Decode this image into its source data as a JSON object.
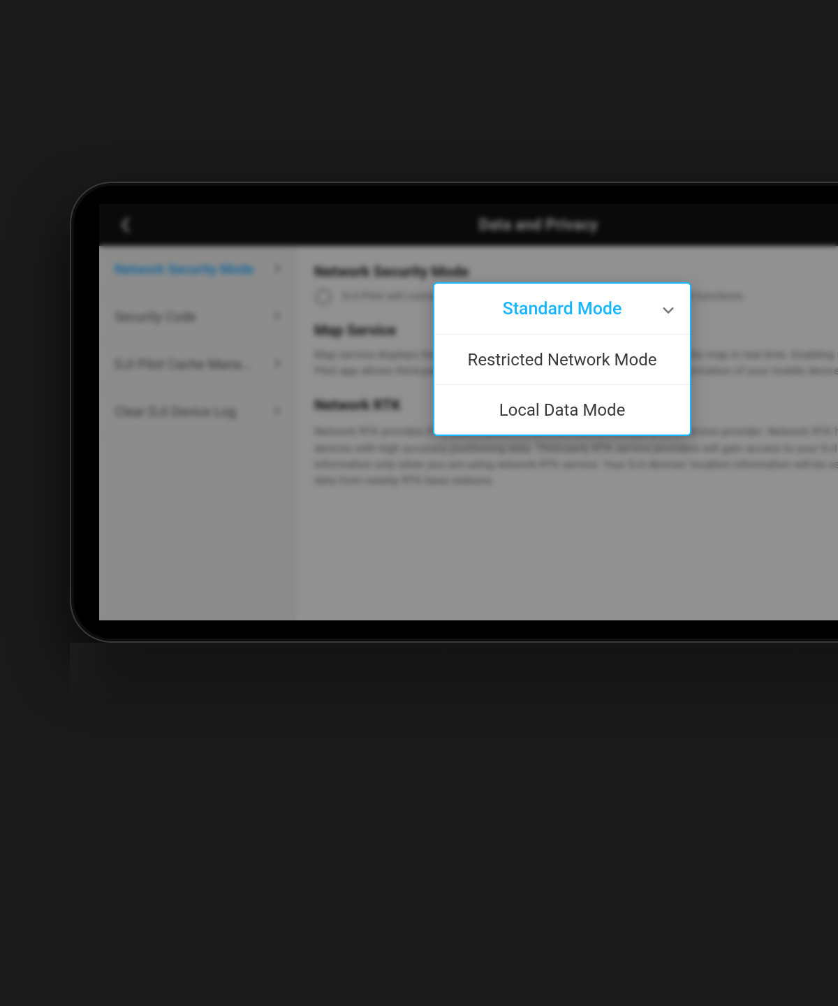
{
  "header": {
    "title": "Data and Privacy"
  },
  "sidebar": {
    "items": [
      {
        "label": "Network Security Mode",
        "active": true
      },
      {
        "label": "Security Code",
        "active": false
      },
      {
        "label": "DJI Pilot Cache Mana...",
        "active": false
      },
      {
        "label": "Clear DJI Device Log",
        "active": false
      }
    ]
  },
  "content": {
    "network_security": {
      "heading": "Network Security Mode",
      "desc": "DJI Pilot will connect to the internet and provide complete features and functions."
    },
    "map_service": {
      "heading": "Map Service",
      "desc": "Map service displays the location of your DJI devices and mobile device on the map in real time. Enabling map services in the DJI Pilot app allows third-party map service providers to access the location information of your mobile device and DJI devices."
    },
    "network_rtk": {
      "heading": "Network RTK",
      "desc": "Network RTK provides RTK data to your DJI devices from a third-party RTK service provider. Network RTK helps you use your DJI devices with high accuracy positioning data. Third-party RTK service providers will gain access to your DJI devices' location information only when you are using network RTK service. Your DJI devices' location information will be used when requesting data from nearby RTK base stations."
    }
  },
  "dropdown": {
    "selected": "Standard Mode",
    "options": [
      "Restricted Network Mode",
      "Local Data Mode"
    ]
  },
  "colors": {
    "accent": "#18b6ff",
    "toggle_on": "#15d075"
  }
}
